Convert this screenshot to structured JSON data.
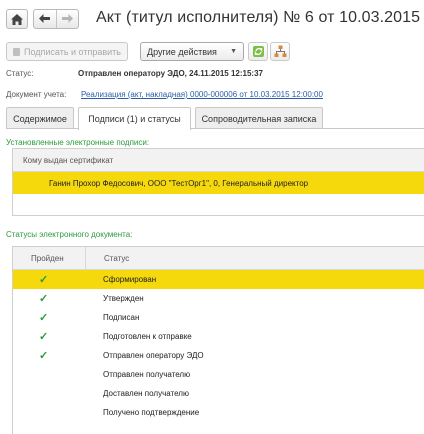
{
  "header": {
    "title": "Акт (титул исполнителя) № 6 от 10.03.2015",
    "home_icon": "home-icon",
    "back_icon": "arrow-left-icon",
    "forward_icon": "arrow-right-icon"
  },
  "toolbar": {
    "sign_send_label": "Подписать и отправить",
    "other_actions_label": "Другие действия",
    "other_actions_caret": "▼"
  },
  "fields": {
    "status_label": "Статус:",
    "status_value": "Отправлен оператору ЭДО, 24.11.2015 12:15:37",
    "doc_label": "Документ учета:",
    "doc_value": "Реализация (акт, накладная) 0000-000006 от 10.03.2015 12:00:00"
  },
  "tabs": [
    {
      "label": "Содержимое"
    },
    {
      "label": "Подписи (1) и статусы"
    },
    {
      "label": "Сопроводительная записка"
    }
  ],
  "signatures": {
    "section_title": "Установленные электронные подписи:",
    "column_header": "Кому выдан сертификат",
    "rows": [
      "Ганин Прохор Федосович, ООО \"ТестОрг1\", 0, Генеральный директор"
    ]
  },
  "statuses": {
    "section_title": "Статусы электронного документа:",
    "col_passed": "Пройден",
    "col_status": "Статус",
    "check_glyph": "✓",
    "rows": [
      {
        "status": "Сформирован",
        "passed": true,
        "selected": true
      },
      {
        "status": "Утвержден",
        "passed": true,
        "selected": false
      },
      {
        "status": "Подписан",
        "passed": true,
        "selected": false
      },
      {
        "status": "Подготовлен к отправке",
        "passed": true,
        "selected": false
      },
      {
        "status": "Отправлен оператору ЭДО",
        "passed": true,
        "selected": false
      },
      {
        "status": "Отправлен получателю",
        "passed": false,
        "selected": false
      },
      {
        "status": "Доставлен получателю",
        "passed": false,
        "selected": false
      },
      {
        "status": "Получено подтверждение",
        "passed": false,
        "selected": false
      }
    ]
  },
  "colors": {
    "selection": "#f5d90d",
    "section_title": "#2c9a3c",
    "link": "#2a5ea8"
  }
}
